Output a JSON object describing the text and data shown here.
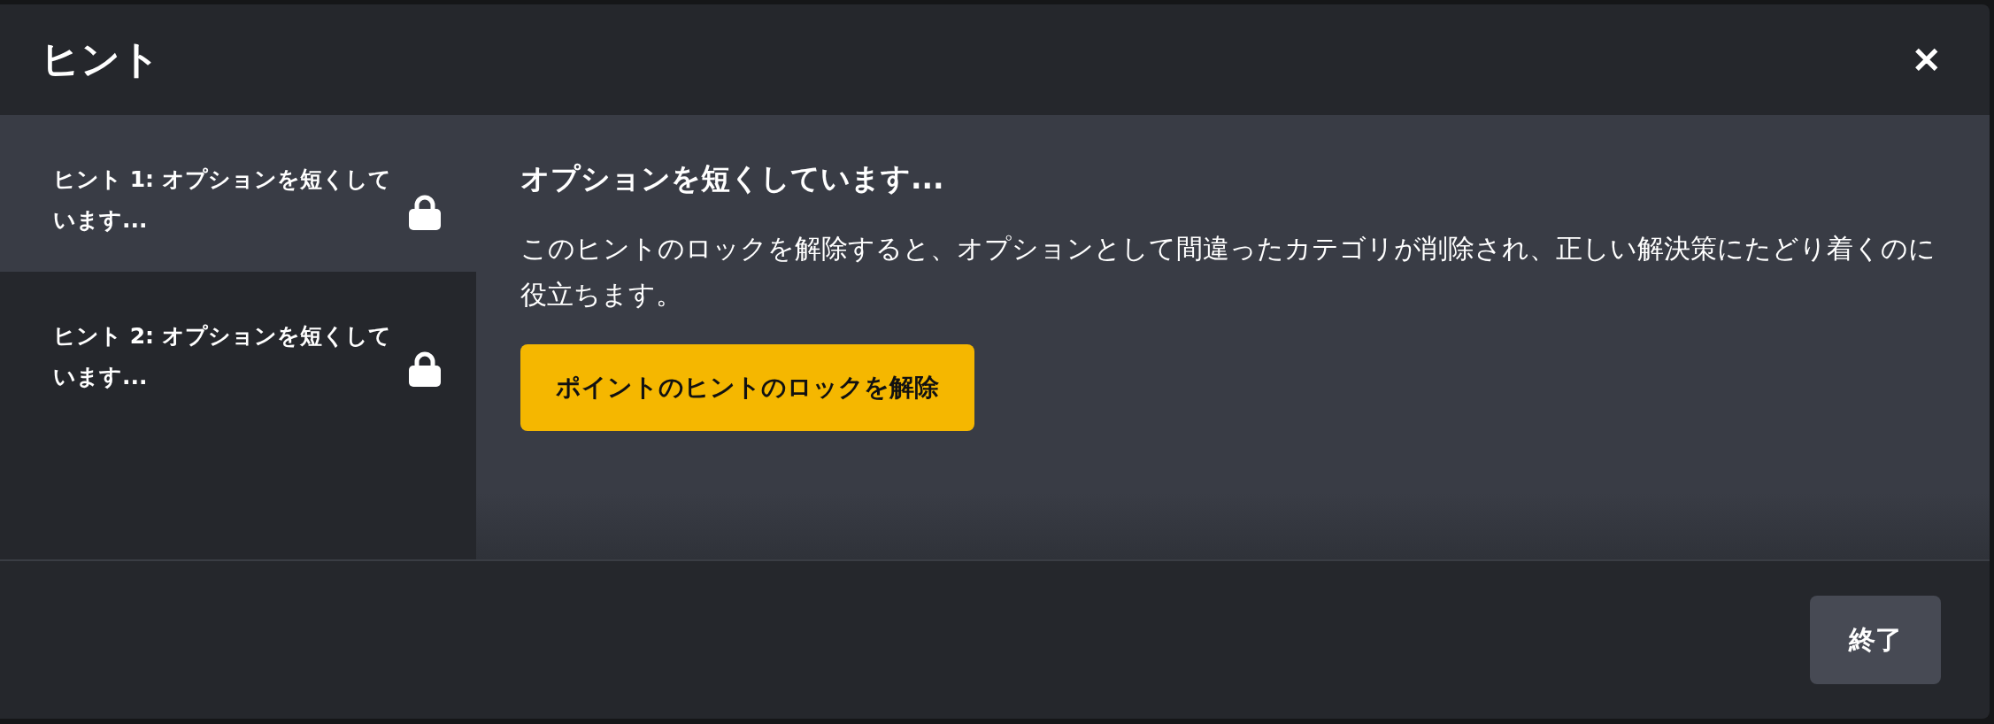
{
  "dialog": {
    "title": "ヒント",
    "close": "✕"
  },
  "hints": [
    {
      "label": "ヒント 1: オプションを短くしています...",
      "selected": true,
      "locked": true
    },
    {
      "label": "ヒント 2: オプションを短くしています...",
      "selected": false,
      "locked": true
    }
  ],
  "detail": {
    "heading": "オプションを短くしています...",
    "body": "このヒントのロックを解除すると、オプションとして間違ったカテゴリが削除され、正しい解決策にたどり着くのに役立ちます。",
    "unlock_button": "ポイントのヒントのロックを解除"
  },
  "footer": {
    "done_button": "終了"
  }
}
